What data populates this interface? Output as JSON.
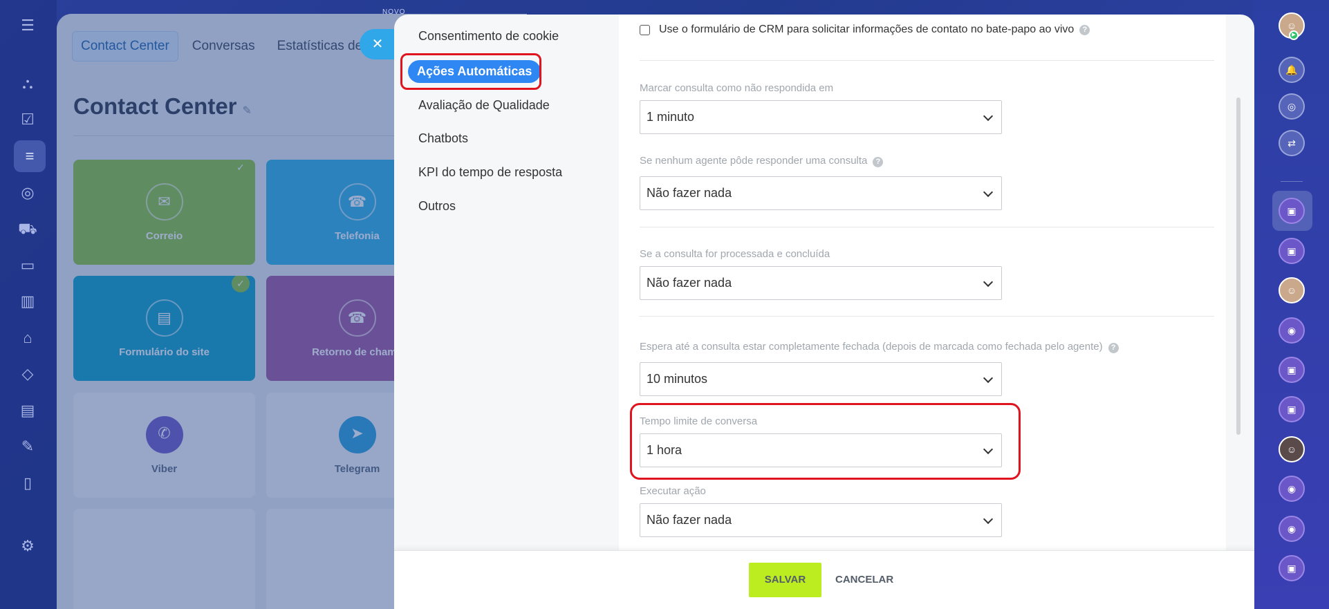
{
  "header": {
    "badge": "NOVO",
    "tabs": [
      {
        "label": "Contact Center"
      },
      {
        "label": "Conversas"
      },
      {
        "label": "Estatísticas de c"
      }
    ],
    "page_title": "Contact Center"
  },
  "tiles": [
    {
      "label": "Correio"
    },
    {
      "label": "Telefonia"
    },
    {
      "label": "Formulário do site"
    },
    {
      "label": "Retorno de chama"
    },
    {
      "label": "Viber"
    },
    {
      "label": "Telegram"
    }
  ],
  "close_glyph": "✕",
  "settings_nav": {
    "items": [
      {
        "label": "Consentimento de cookie"
      },
      {
        "label": "Ações Automáticas"
      },
      {
        "label": "Avaliação de Qualidade"
      },
      {
        "label": "Chatbots"
      },
      {
        "label": "KPI do tempo de resposta"
      },
      {
        "label": "Outros"
      }
    ]
  },
  "form": {
    "crm_checkbox_label": "Use o formulário de CRM para solicitar informações de contato no bate-papo ao vivo",
    "help_glyph": "?",
    "fields": [
      {
        "label": "Marcar consulta como não respondida em",
        "value": "1 minuto"
      },
      {
        "label": "Se nenhum agente pôde responder uma consulta",
        "value": "Não fazer nada"
      },
      {
        "label": "Se a consulta for processada e concluída",
        "value": "Não fazer nada"
      },
      {
        "label": "Espera até a consulta estar completamente fechada (depois de marcada como fechada pelo agente)",
        "value": "10 minutos"
      },
      {
        "label": "Tempo limite de conversa",
        "value": "1 hora"
      },
      {
        "label": "Executar ação",
        "value": "Não fazer nada"
      }
    ]
  },
  "footer": {
    "save_label": "SALVAR",
    "cancel_label": "CANCELAR"
  },
  "colors": {
    "accent_blue": "#2f87f3",
    "highlight_red": "#e0141e",
    "save_green": "#bbed21"
  }
}
